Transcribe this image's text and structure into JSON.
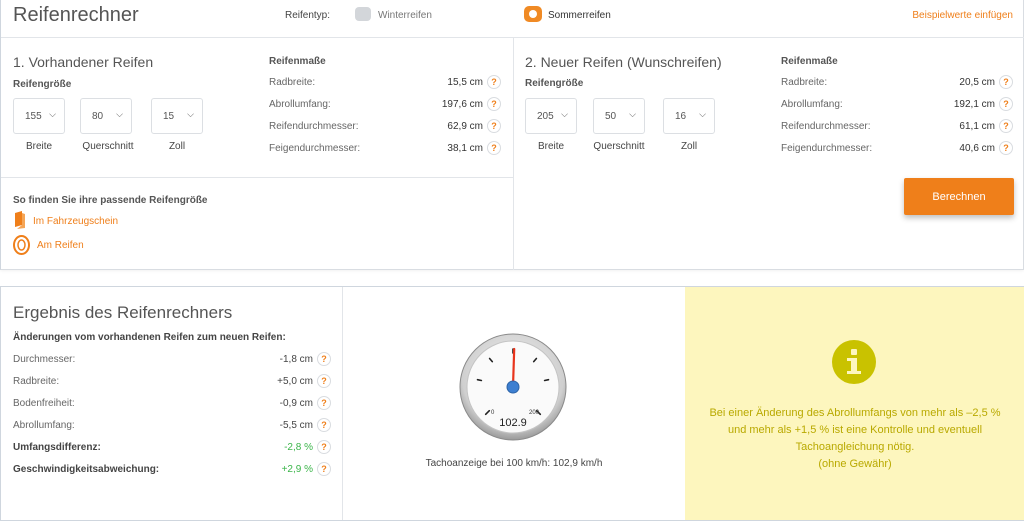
{
  "header": {
    "title": "Reifenrechner",
    "tire_type_label": "Reifentyp:",
    "option_winter": "Winterreifen",
    "option_summer": "Sommerreifen",
    "example_link": "Beispielwerte einfügen"
  },
  "existing": {
    "title": "1. Vorhandener Reifen",
    "size_label": "Reifengröße",
    "selects": [
      {
        "value": "155",
        "caption": "Breite"
      },
      {
        "value": "80",
        "caption": "Querschnitt"
      },
      {
        "value": "15",
        "caption": "Zoll"
      }
    ],
    "dims_title": "Reifenmaße",
    "dims": [
      {
        "label": "Radbreite:",
        "value": "15,5 cm"
      },
      {
        "label": "Abrollumfang:",
        "value": "197,6 cm"
      },
      {
        "label": "Reifendurchmesser:",
        "value": "62,9 cm"
      },
      {
        "label": "Feigendurchmesser:",
        "value": "38,1 cm"
      }
    ]
  },
  "new": {
    "title": "2. Neuer Reifen (Wunschreifen)",
    "size_label": "Reifengröße",
    "selects": [
      {
        "value": "205",
        "caption": "Breite"
      },
      {
        "value": "50",
        "caption": "Querschnitt"
      },
      {
        "value": "16",
        "caption": "Zoll"
      }
    ],
    "dims_title": "Reifenmaße",
    "dims": [
      {
        "label": "Radbreite:",
        "value": "20,5 cm"
      },
      {
        "label": "Abrollumfang:",
        "value": "192,1 cm"
      },
      {
        "label": "Reifendurchmesser:",
        "value": "61,1 cm"
      },
      {
        "label": "Feigendurchmesser:",
        "value": "40,6 cm"
      }
    ]
  },
  "finder": {
    "title": "So finden Sie ihre passende Reifengröße",
    "link_registration": "Im Fahrzeugschein",
    "link_tire": "Am Reifen"
  },
  "calculate_button": "Berechnen",
  "help_glyph": "?",
  "result": {
    "title": "Ergebnis des Reifenrechners",
    "subtitle": "Änderungen vom vorhandenen Reifen zum neuen Reifen:",
    "rows": [
      {
        "label": "Durchmesser:",
        "value": "-1,8 cm"
      },
      {
        "label": "Radbreite:",
        "value": "+5,0 cm"
      },
      {
        "label": "Bodenfreiheit:",
        "value": "-0,9 cm"
      },
      {
        "label": "Abrollumfang:",
        "value": "-5,5 cm"
      },
      {
        "label": "Umfangsdifferenz:",
        "value": "-2,8 %"
      },
      {
        "label": "Geschwindigkeitsabweichung:",
        "value": "+2,9 %"
      }
    ]
  },
  "speedometer": {
    "reading": "102.9",
    "scale_min": "0",
    "scale_max": "200",
    "caption": "Tachoanzeige bei 100 km/h: 102,9 km/h"
  },
  "info": {
    "text": "Bei einer Änderung des Abrollumfangs von mehr als –2,5 % und mehr als +1,5 % ist eine Kontrolle und eventuell Tachoangleichung nötig.",
    "note": "(ohne Gewähr)"
  },
  "colors": {
    "accent": "#ef7f1a",
    "positive": "#3bb54a",
    "info_bg": "#fdf6be",
    "info_icon": "#c9c200"
  }
}
